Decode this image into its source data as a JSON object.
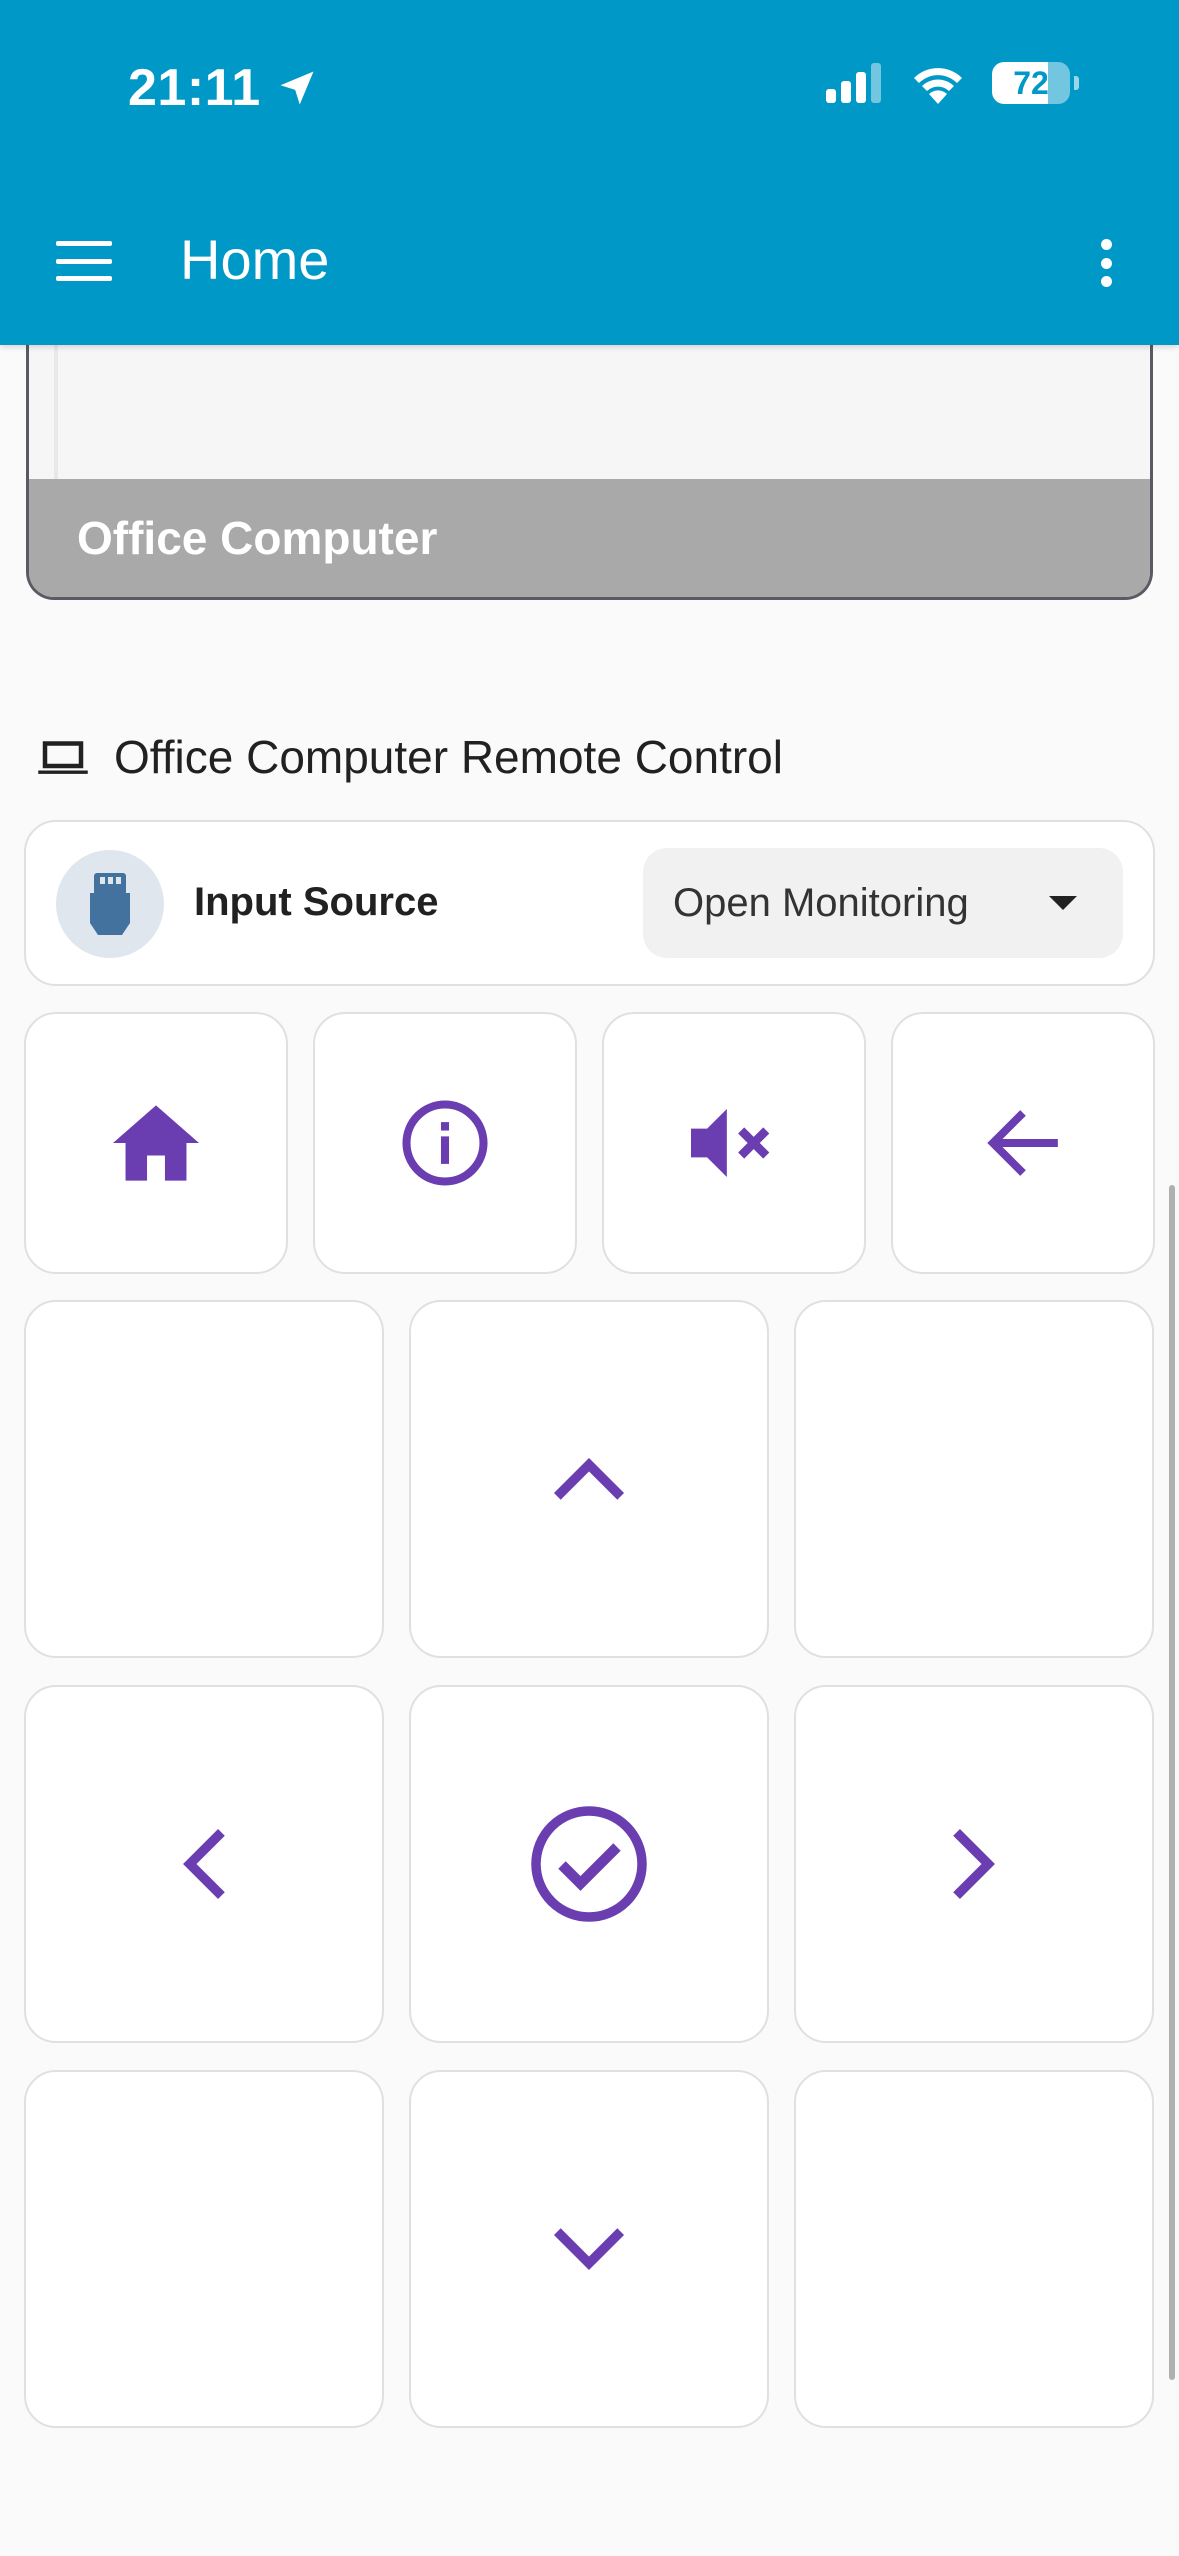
{
  "status_bar": {
    "time": "21:11",
    "battery_percent": 72
  },
  "toolbar": {
    "title": "Home"
  },
  "camera": {
    "caption": "Office Computer"
  },
  "remote": {
    "section_title": "Office Computer Remote Control",
    "input_source": {
      "label": "Input Source",
      "selected": "Open Monitoring"
    },
    "accent_color": "#6a3db0",
    "row1_buttons": [
      "home-icon",
      "info-icon",
      "volume-mute-icon",
      "arrow-back-icon"
    ],
    "dpad_buttons": [
      "chevron-up-icon",
      "chevron-left-icon",
      "check-circle-icon",
      "chevron-right-icon",
      "chevron-down-icon"
    ]
  },
  "colors": {
    "header": "#0098c7",
    "background": "#fafafa",
    "accent": "#6a3db0"
  }
}
